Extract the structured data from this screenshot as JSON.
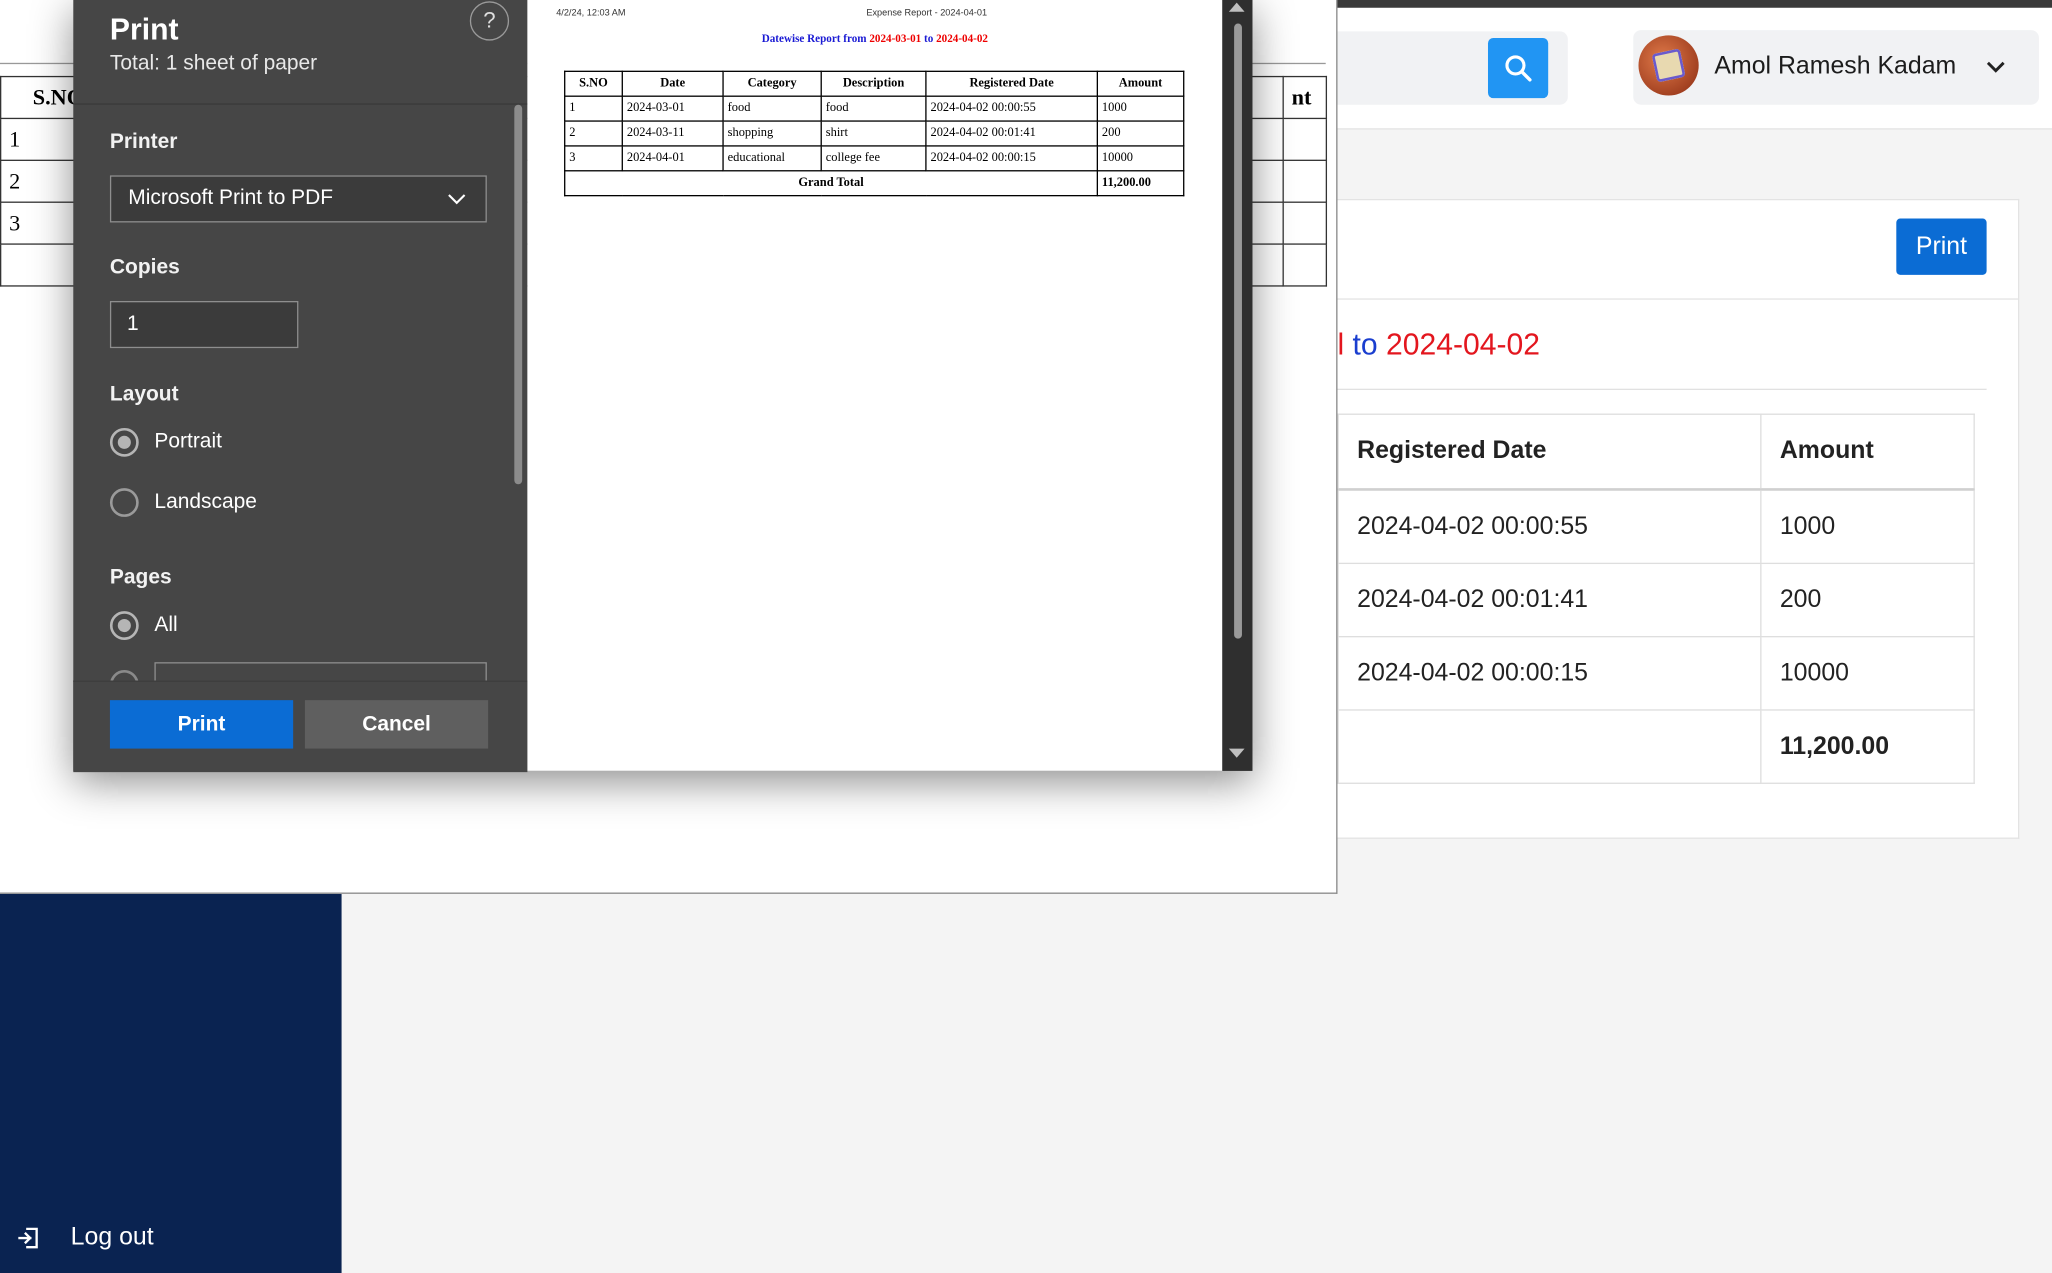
{
  "app": {
    "user_name": "Amol Ramesh Kadam",
    "print_button": "Print",
    "heading_from_fragment": "l",
    "heading_to": "to",
    "heading_end_date": "2024-04-02",
    "table_headers": [
      "Registered Date",
      "Amount"
    ],
    "rows": [
      {
        "registered": "2024-04-02 00:00:55",
        "amount": "1000"
      },
      {
        "registered": "2024-04-02 00:01:41",
        "amount": "200"
      },
      {
        "registered": "2024-04-02 00:00:15",
        "amount": "10000"
      }
    ],
    "grand_total": "11,200.00",
    "sidebar_logout": "Log out",
    "colors": {
      "accent": "#0b6cd4",
      "sidebar": "#0a2351",
      "search": "#2195f3",
      "date_red": "#e3161e"
    }
  },
  "background_doc": {
    "header_sno": "S.NO",
    "header_amount_fragment": "nt",
    "sno": [
      "1",
      "2",
      "3"
    ]
  },
  "dialog": {
    "title": "Print",
    "subtitle": "Total: 1 sheet of paper",
    "help": "?",
    "printer_label": "Printer",
    "printer_value": "Microsoft Print to PDF",
    "copies_label": "Copies",
    "copies_value": "1",
    "layout_label": "Layout",
    "layout_options": [
      "Portrait",
      "Landscape"
    ],
    "layout_selected": "Portrait",
    "pages_label": "Pages",
    "pages_option_all": "All",
    "print_button": "Print",
    "cancel_button": "Cancel"
  },
  "preview": {
    "header_left": "4/2/24, 12:03 AM",
    "header_center": "Expense Report - 2024-04-01",
    "title_prefix": "Datewise Report from",
    "title_from": "2024-03-01",
    "title_to_word": "to",
    "title_to": "2024-04-02",
    "columns": [
      "S.NO",
      "Date",
      "Category",
      "Description",
      "Registered Date",
      "Amount"
    ],
    "rows": [
      [
        "1",
        "2024-03-01",
        "food",
        "food",
        "2024-04-02 00:00:55",
        "1000"
      ],
      [
        "2",
        "2024-03-11",
        "shopping",
        "shirt",
        "2024-04-02 00:01:41",
        "200"
      ],
      [
        "3",
        "2024-04-01",
        "educational",
        "college fee",
        "2024-04-02 00:00:15",
        "10000"
      ]
    ],
    "grand_total_label": "Grand Total",
    "grand_total_value": "11,200.00"
  }
}
